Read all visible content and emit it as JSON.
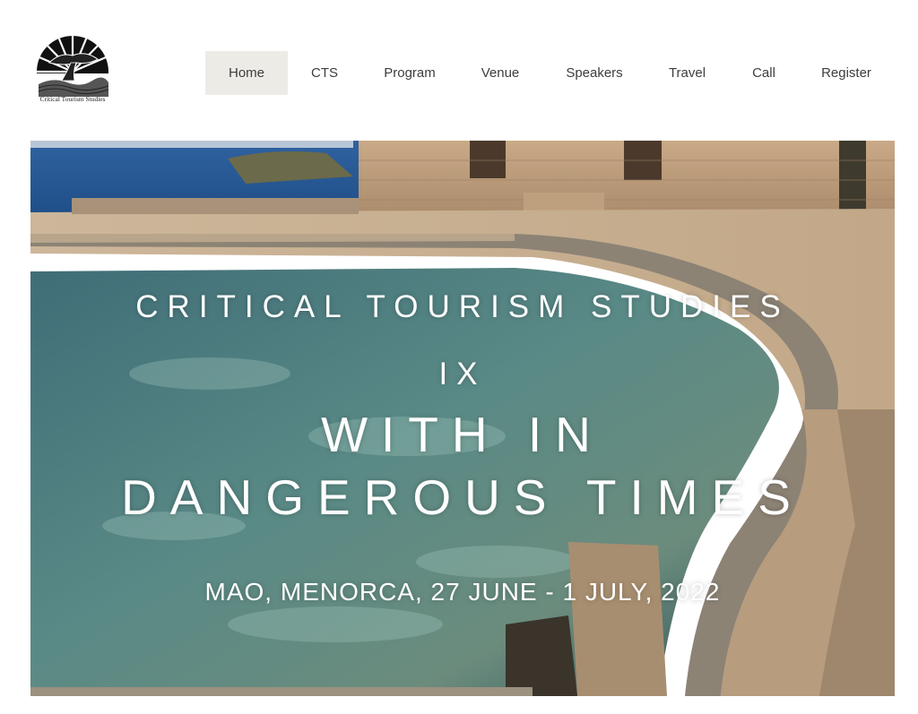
{
  "logo": {
    "caption": "Critical Tourism Studies",
    "icon": "sunburst-tree-logo"
  },
  "nav": {
    "items": [
      {
        "label": "Home",
        "active": true
      },
      {
        "label": "CTS",
        "active": false
      },
      {
        "label": "Program",
        "active": false
      },
      {
        "label": "Venue",
        "active": false
      },
      {
        "label": "Speakers",
        "active": false
      },
      {
        "label": "Travel",
        "active": false
      },
      {
        "label": "Call",
        "active": false
      },
      {
        "label": "Register",
        "active": false
      }
    ]
  },
  "hero": {
    "title_line1": "CRITICAL TOURISM STUDIES",
    "title_line2": "IX",
    "theme_line1": "WITH IN",
    "theme_line2": "DANGEROUS TIMES",
    "location_dates": "MAO, MENORCA, 27 JUNE - 1 JULY, 2022",
    "image": "sea-pool-stone-building-photo"
  },
  "colors": {
    "nav_active_bg": "#edebe6",
    "nav_text": "#3d3d3d",
    "hero_text": "#ffffff"
  }
}
